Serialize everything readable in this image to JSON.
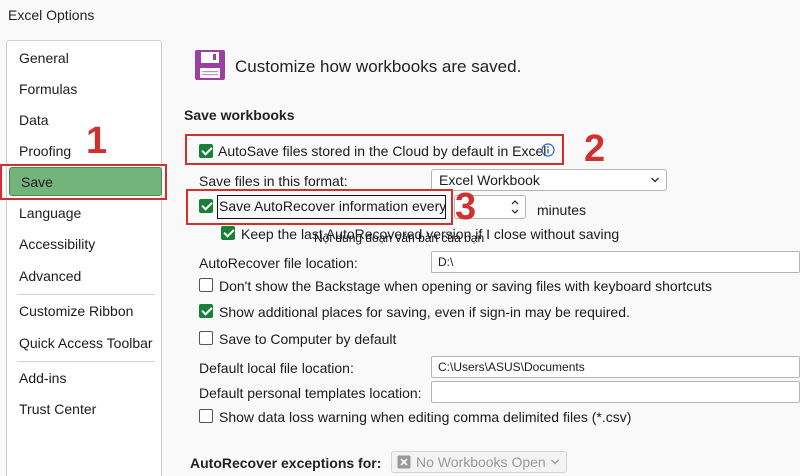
{
  "window": {
    "title": "Excel Options"
  },
  "sidebar": {
    "items": [
      {
        "label": "General"
      },
      {
        "label": "Formulas"
      },
      {
        "label": "Data"
      },
      {
        "label": "Proofing"
      },
      {
        "label": "Save"
      },
      {
        "label": "Language"
      },
      {
        "label": "Accessibility"
      },
      {
        "label": "Advanced"
      },
      {
        "label": "Customize Ribbon"
      },
      {
        "label": "Quick Access Toolbar"
      },
      {
        "label": "Add-ins"
      },
      {
        "label": "Trust Center"
      }
    ],
    "selected": "Save"
  },
  "header": {
    "text": "Customize how workbooks are saved.",
    "icon": "save-floppy-icon"
  },
  "save_workbooks": {
    "title": "Save workbooks",
    "autosave": {
      "label": "AutoSave files stored in the Cloud by default in Excel",
      "checked": true
    },
    "format": {
      "label": "Save files in this format:",
      "value": "Excel Workbook"
    },
    "autorecover": {
      "label": "Save AutoRecover information every",
      "checked": true,
      "minutes_value": "",
      "minutes_label": "minutes"
    },
    "keep_last": {
      "label": "Keep the last AutoRecovered version if I close without saving",
      "checked": true
    },
    "autorecover_location": {
      "label": "AutoRecover file location:",
      "value": "D:\\"
    },
    "dont_show_backstage": {
      "label": "Don't show the Backstage when opening or saving files with keyboard shortcuts",
      "checked": false
    },
    "show_additional": {
      "label": "Show additional places for saving, even if sign-in may be required.",
      "checked": true
    },
    "save_to_computer": {
      "label": "Save to Computer by default",
      "checked": false
    },
    "default_local": {
      "label": "Default local file location:",
      "value": "C:\\Users\\ASUS\\Documents"
    },
    "default_templates": {
      "label": "Default personal templates location:",
      "value": ""
    },
    "data_loss_warning": {
      "label": "Show data loss warning when editing comma delimited files (*.csv)",
      "checked": false
    }
  },
  "autorecover_exceptions": {
    "label": "AutoRecover exceptions for:",
    "value": "No Workbooks Open"
  },
  "annotations": {
    "num1": "1",
    "num2": "2",
    "num3": "3",
    "overlay_text": "Nội dung đoạn văn bản của bạn"
  },
  "colors": {
    "accent_green": "#73b47d",
    "checkbox_green": "#1a7f37",
    "annotation_red": "#d32f2f",
    "save_icon_purple": "#9b3fa0"
  }
}
